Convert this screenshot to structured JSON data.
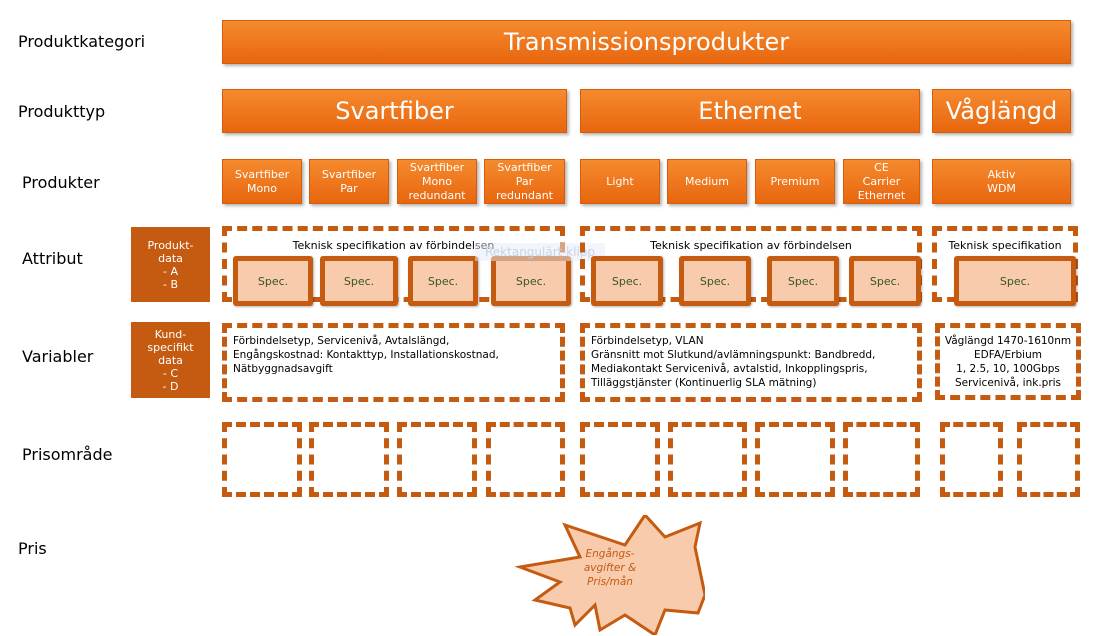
{
  "colors": {
    "orange": "#e8660e",
    "dark_orange": "#c55a11",
    "spec_fill": "#f8cbad",
    "spec_text": "#375623"
  },
  "row_labels": [
    "Produktkategori",
    "Produkttyp",
    "Produkter",
    "Attribut",
    "Variabler",
    "Prisområde",
    "Pris"
  ],
  "category": "Transmissionsprodukter",
  "types": [
    "Svartfiber",
    "Ethernet",
    "Våglängd"
  ],
  "products": [
    [
      "Svartfiber",
      "Mono"
    ],
    [
      "Svartfiber",
      "Par"
    ],
    [
      "Svartfiber",
      "Mono",
      "redundant"
    ],
    [
      "Svartfiber",
      "Par",
      "redundant"
    ],
    [
      "Light"
    ],
    [
      "Medium"
    ],
    [
      "Premium"
    ],
    [
      "CE",
      "Carrier",
      "Ethernet"
    ],
    [
      "Aktiv",
      "WDM"
    ]
  ],
  "side_boxes": [
    [
      "Produkt-",
      "data",
      "- A",
      "- B"
    ],
    [
      "Kund-",
      "specifikt",
      "data",
      "- C",
      "- D"
    ]
  ],
  "attributes": [
    {
      "title": "Teknisk specifikation av förbindelsen",
      "spec": "Spec."
    },
    {
      "title": "Teknisk specifikation av förbindelsen",
      "spec": "Spec."
    },
    {
      "title": "Teknisk specifikation",
      "spec": "Spec."
    }
  ],
  "tooltip": "Rektangulärt klipp",
  "variables": [
    [
      "Förbindelsetyp, Servicenivå, Avtalslängd,",
      "Engångskostnad: Kontakttyp, Installationskostnad,",
      "Nätbyggnadsavgift"
    ],
    [
      "Förbindelsetyp, VLAN",
      "Gränsnitt mot Slutkund/avlämningspunkt: Bandbredd,",
      "Mediakontakt Servicenivå, avtalstid, Inkopplingspris,",
      "Tilläggstjänster (Kontinuerlig SLA mätning)"
    ],
    [
      "Våglängd 1470-1610nm",
      "EDFA/Erbium",
      "1, 2.5, 10, 100Gbps",
      "Servicenivå, ink.pris"
    ]
  ],
  "price": [
    "Engångs-",
    "avgifter &",
    "Pris/mån"
  ]
}
